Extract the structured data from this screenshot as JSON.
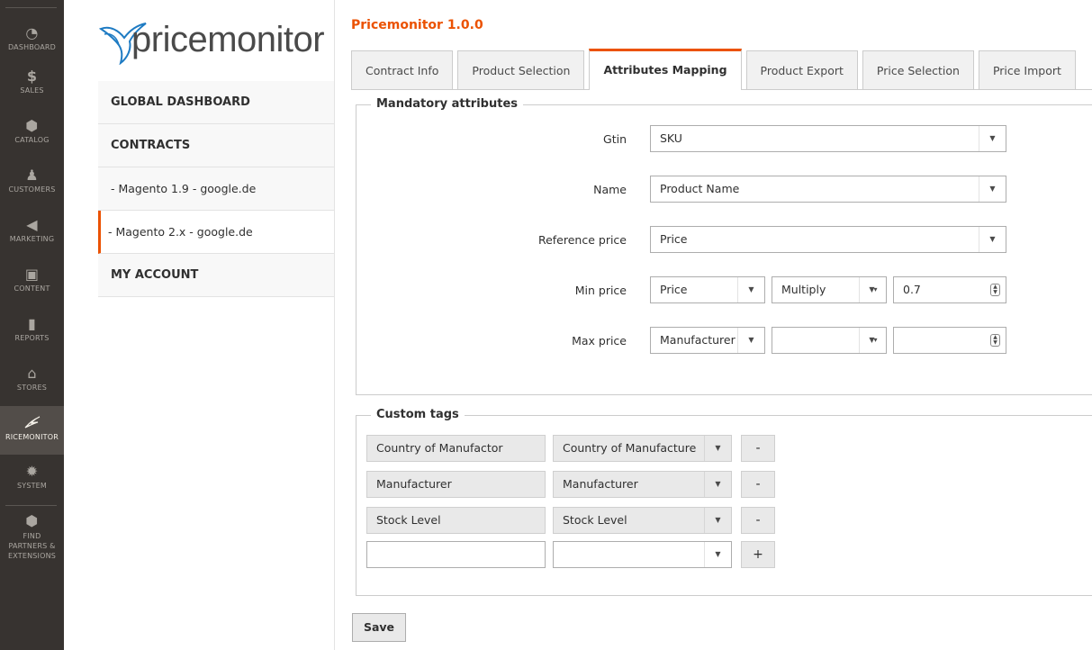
{
  "admin_menu": {
    "items": [
      {
        "label": "DASHBOARD",
        "icon": "dashboard-icon",
        "glyph": "◔"
      },
      {
        "label": "SALES",
        "icon": "dollar-icon",
        "glyph": "$"
      },
      {
        "label": "CATALOG",
        "icon": "cube-icon",
        "glyph": "⬢"
      },
      {
        "label": "CUSTOMERS",
        "icon": "person-icon",
        "glyph": "♟"
      },
      {
        "label": "MARKETING",
        "icon": "megaphone-icon",
        "glyph": "◀"
      },
      {
        "label": "CONTENT",
        "icon": "layout-icon",
        "glyph": "▣"
      },
      {
        "label": "REPORTS",
        "icon": "bar-chart-icon",
        "glyph": "▮"
      },
      {
        "label": "STORES",
        "icon": "store-icon",
        "glyph": "⌂"
      },
      {
        "label": "RICEMONITOR",
        "icon": "hummingbird-icon",
        "glyph": "✦"
      },
      {
        "label": "SYSTEM",
        "icon": "gear-icon",
        "glyph": "✹"
      },
      {
        "label_lines": [
          "FIND",
          "PARTNERS &",
          "EXTENSIONS"
        ],
        "icon": "box-icon",
        "glyph": "⬢"
      }
    ]
  },
  "sidebar": {
    "logo_text": "pricemonitor",
    "items": [
      {
        "label": "GLOBAL DASHBOARD",
        "type": "head"
      },
      {
        "label": "CONTRACTS",
        "type": "head"
      },
      {
        "label": "- Magento 1.9 - google.de",
        "type": "sub"
      },
      {
        "label": "- Magento 2.x - google.de",
        "type": "sub",
        "active": true
      },
      {
        "label": "MY ACCOUNT",
        "type": "head"
      }
    ]
  },
  "page": {
    "title": "Pricemonitor 1.0.0"
  },
  "tabs": [
    {
      "label": "Contract Info"
    },
    {
      "label": "Product Selection"
    },
    {
      "label": "Attributes Mapping",
      "active": true
    },
    {
      "label": "Product Export"
    },
    {
      "label": "Price Selection"
    },
    {
      "label": "Price Import"
    }
  ],
  "mandatory": {
    "legend": "Mandatory attributes",
    "gtin": {
      "label": "Gtin",
      "value": "SKU"
    },
    "name": {
      "label": "Name",
      "value": "Product Name"
    },
    "reference_price": {
      "label": "Reference price",
      "value": "Price"
    },
    "min_price": {
      "label": "Min price",
      "attribute": "Price",
      "operation": "Multiply",
      "value": "0.7"
    },
    "max_price": {
      "label": "Max price",
      "attribute": "Manufacturer",
      "operation": "",
      "value": ""
    }
  },
  "custom_tags": {
    "legend": "Custom tags",
    "rows": [
      {
        "name": "Country of Manufactor",
        "attribute": "Country of Manufacture",
        "button": "-"
      },
      {
        "name": "Manufacturer",
        "attribute": "Manufacturer",
        "button": "-"
      },
      {
        "name": "Stock Level",
        "attribute": "Stock Level",
        "button": "-"
      },
      {
        "name": "",
        "attribute": "",
        "button": "+"
      }
    ]
  },
  "save_label": "Save",
  "colors": {
    "accent": "#eb5202",
    "admin_menu_bg": "#373330",
    "logo_bird": "#1e7bc3"
  }
}
